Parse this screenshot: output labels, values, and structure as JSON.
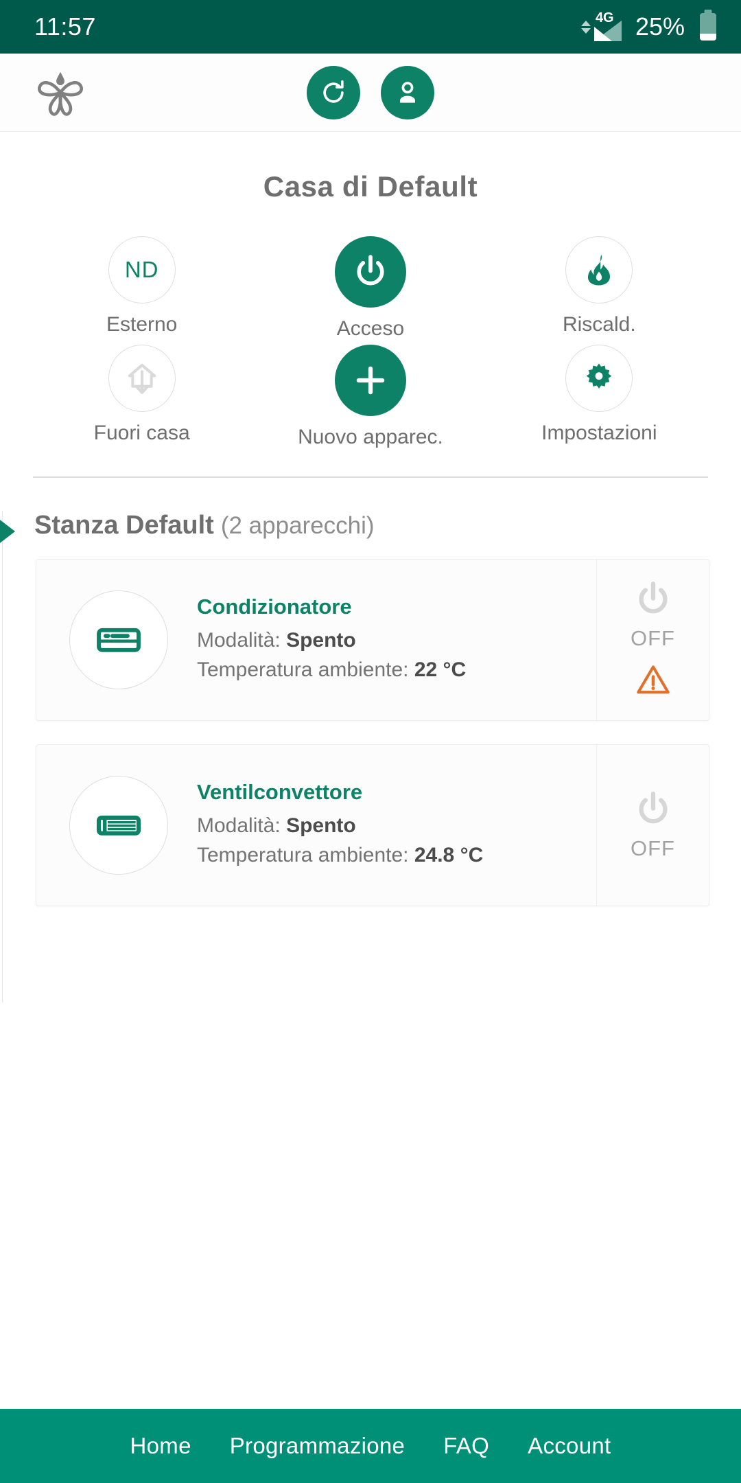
{
  "colors": {
    "status_bar_bg": "#005a4b",
    "accent": "#0e8266",
    "bottom_nav_bg": "#009078",
    "warning": "#e0702a",
    "muted_text": "#6e6e6e"
  },
  "status_bar": {
    "time": "11:57",
    "network_type": "4G",
    "battery_percent": "25%",
    "icons": [
      "data-transfer-icon",
      "signal-bars-icon",
      "battery-icon"
    ]
  },
  "app_bar": {
    "logo_name": "butterfly-logo",
    "actions": [
      {
        "name": "refresh-button",
        "icon": "refresh-icon"
      },
      {
        "name": "account-button",
        "icon": "user-icon"
      }
    ]
  },
  "home": {
    "title": "Casa di Default",
    "quick_actions": [
      {
        "label": "Esterno",
        "icon": "outdoor-temperature-icon",
        "value": "ND",
        "style": "outline"
      },
      {
        "label": "Acceso",
        "icon": "power-icon",
        "value": "",
        "style": "filled"
      },
      {
        "label": "Riscald.",
        "icon": "flame-icon",
        "value": "",
        "style": "outline"
      },
      {
        "label": "Fuori casa",
        "icon": "away-home-icon",
        "value": "",
        "style": "outline-dim"
      },
      {
        "label": "Nuovo apparec.",
        "icon": "plus-icon",
        "value": "",
        "style": "filled"
      },
      {
        "label": "Impostazioni",
        "icon": "gear-icon",
        "value": "",
        "style": "outline"
      }
    ]
  },
  "room": {
    "name": "Stanza Default",
    "count_label": "(2 apparecchi)",
    "devices": [
      {
        "name": "Condizionatore",
        "icon": "air-conditioner-icon",
        "mode_label": "Modalità:",
        "mode_value": "Spento",
        "temp_label": "Temperatura ambiente:",
        "temp_value": "22 °C",
        "state": "OFF",
        "state_icon": "power-icon",
        "has_warning": true,
        "warning_icon": "warning-triangle-icon"
      },
      {
        "name": "Ventilconvettore",
        "icon": "fan-coil-icon",
        "mode_label": "Modalità:",
        "mode_value": "Spento",
        "temp_label": "Temperatura ambiente:",
        "temp_value": "24.8 °C",
        "state": "OFF",
        "state_icon": "power-icon",
        "has_warning": false,
        "warning_icon": ""
      }
    ]
  },
  "bottom_nav": {
    "items": [
      {
        "label": "Home"
      },
      {
        "label": "Programmazione"
      },
      {
        "label": "FAQ"
      },
      {
        "label": "Account"
      }
    ]
  }
}
